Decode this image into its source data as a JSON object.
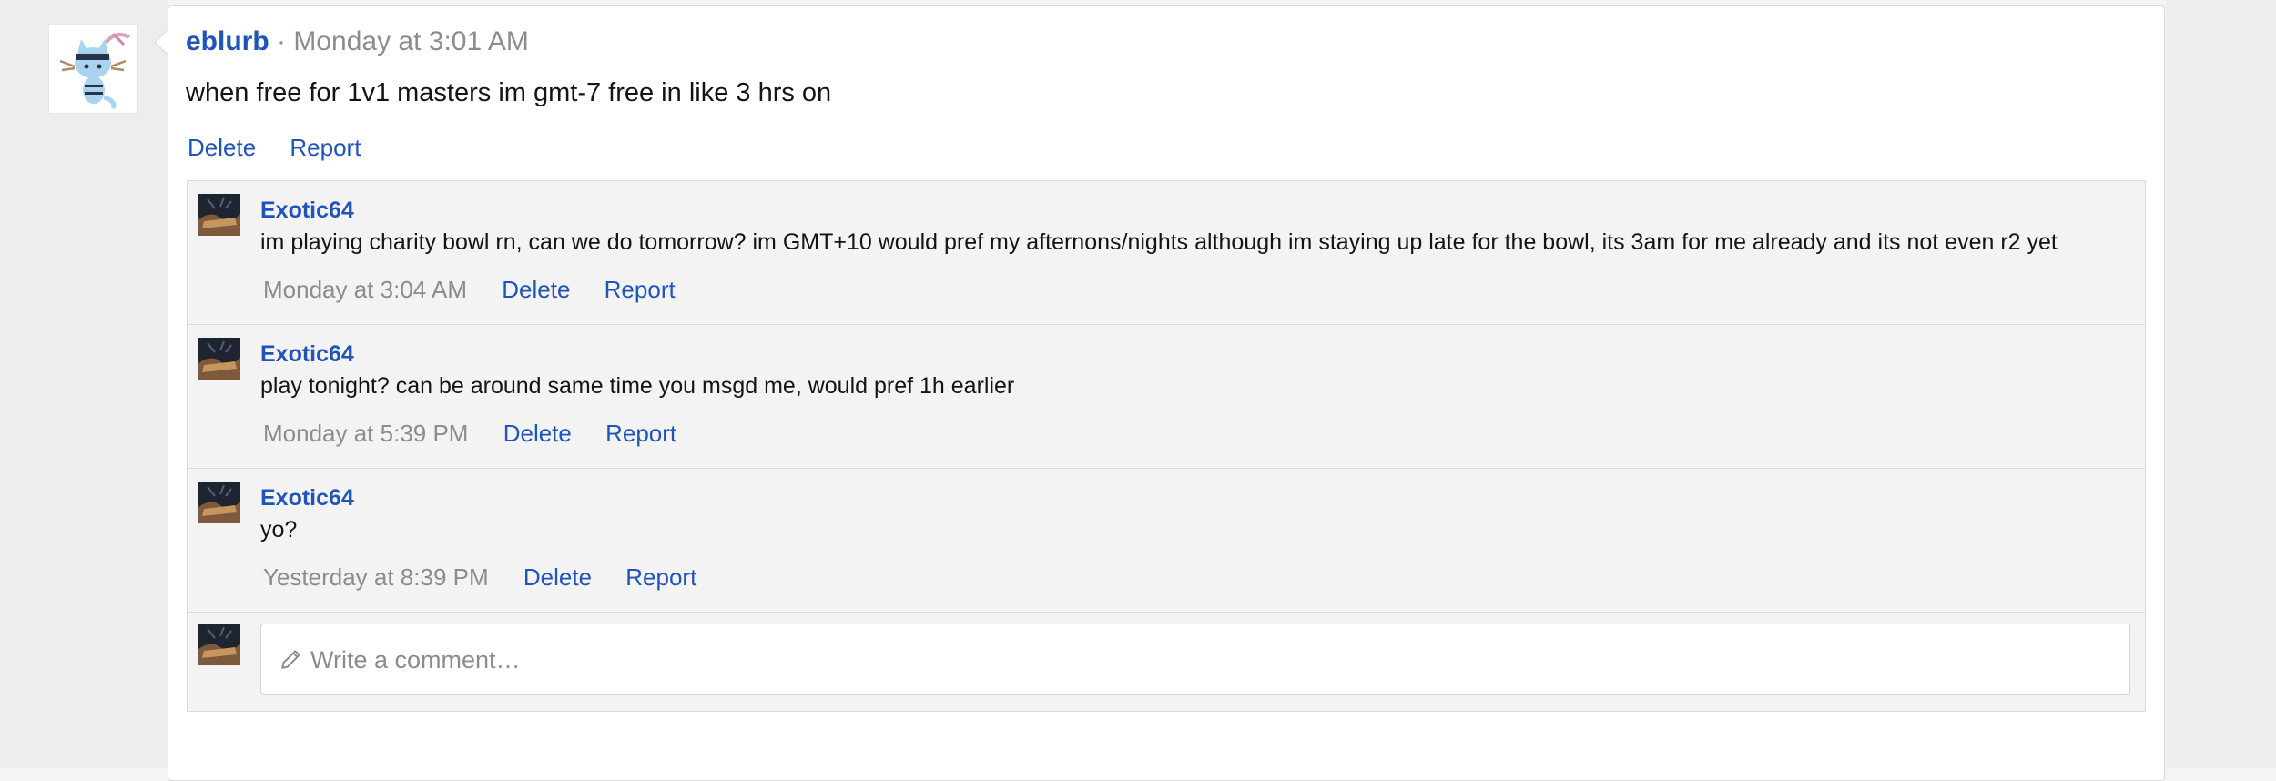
{
  "post": {
    "author": "eblurb",
    "separator": "·",
    "timestamp": "Monday at 3:01 AM",
    "body": "when free for 1v1 masters im gmt-7 free in like 3 hrs on",
    "actions": {
      "delete": "Delete",
      "report": "Report"
    }
  },
  "comments": [
    {
      "author": "Exotic64",
      "text": "im playing charity bowl rn, can we do tomorrow? im GMT+10 would pref my afternons/nights although im staying up late for the bowl, its 3am for me already and its not even r2 yet",
      "timestamp": "Monday at 3:04 AM",
      "delete": "Delete",
      "report": "Report"
    },
    {
      "author": "Exotic64",
      "text": "play tonight? can be around same time you msgd me, would pref 1h earlier",
      "timestamp": "Monday at 5:39 PM",
      "delete": "Delete",
      "report": "Report"
    },
    {
      "author": "Exotic64",
      "text": "yo?",
      "timestamp": "Yesterday at 8:39 PM",
      "delete": "Delete",
      "report": "Report"
    }
  ],
  "composer": {
    "placeholder": "Write a comment…",
    "icon": "pencil-icon"
  },
  "colors": {
    "link": "#2154b9",
    "muted": "#8c8c8c",
    "panel": "#f3f3f3"
  }
}
